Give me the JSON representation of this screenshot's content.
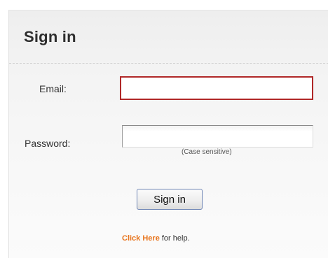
{
  "form": {
    "title": "Sign in",
    "email_label": "Email:",
    "email_value": "",
    "password_label": "Password:",
    "password_value": "",
    "password_hint": "(Case sensitive)",
    "submit_label": "Sign in"
  },
  "help": {
    "link_text": "Click Here",
    "trailing_text": "for help."
  },
  "colors": {
    "focus_border": "#b02828",
    "link": "#e8741c",
    "button_border": "#6f86b5"
  }
}
